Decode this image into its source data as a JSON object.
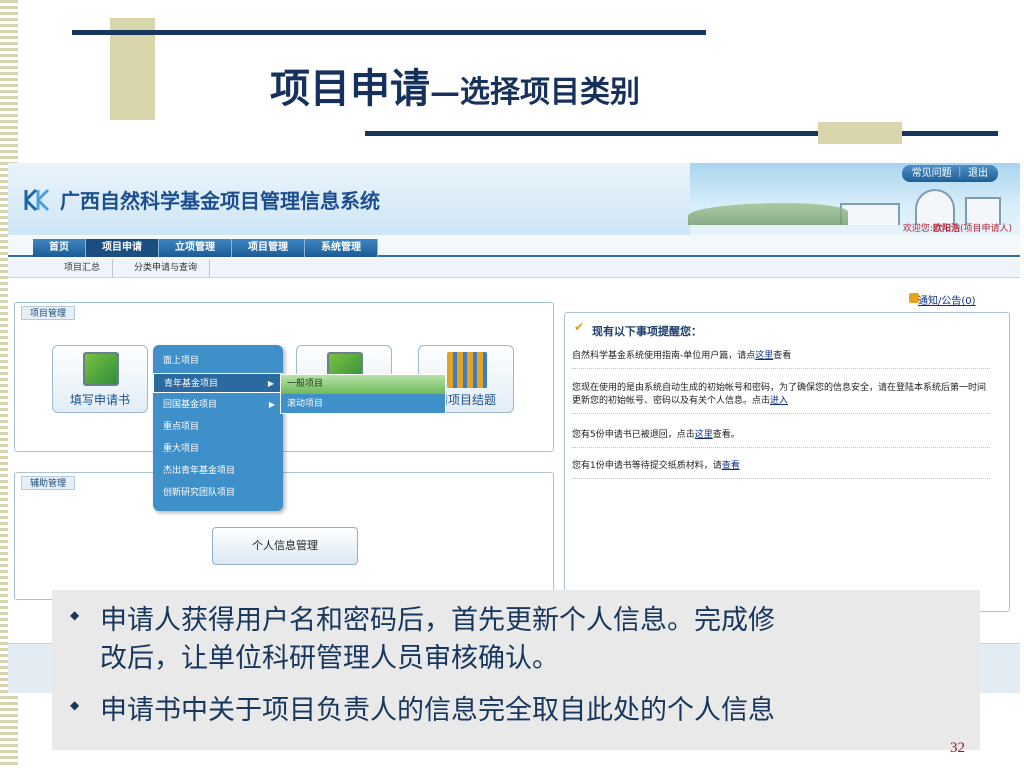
{
  "slide": {
    "title_main": "项目申请",
    "title_sub": "—选择项目类别",
    "page_number": "32"
  },
  "system": {
    "title": "广西自然科学基金项目管理信息系统",
    "top_links": "常见问题 ｜ 退出",
    "welcome_prefix": "欢迎您:",
    "welcome_user": "欧阳浩",
    "welcome_role": "(项目申请人)"
  },
  "main_nav": [
    "首页",
    "项目申请",
    "立项管理",
    "项目管理",
    "系统管理"
  ],
  "sub_nav": [
    "项目汇总",
    "分类申请与查询"
  ],
  "panels": {
    "project_mgmt_tab": "项目管理",
    "aux_mgmt_tab": "辅助管理"
  },
  "icon_buttons": {
    "fill_application": "填写申请书",
    "project_conclusion": "请项目结题"
  },
  "menu": {
    "items": [
      "面上项目",
      "青年基金项目",
      "回国基金项目",
      "重点项目",
      "重大项目",
      "杰出青年基金项目",
      "创新研究团队项目"
    ],
    "highlighted_index": 1,
    "arrow": "▶",
    "submenu": [
      "一般项目",
      "滚动项目"
    ]
  },
  "personal_info_button": "个人信息管理",
  "notices": {
    "link": "通知/公告(0)",
    "remind_title": "现有以下事项提醒您：",
    "rows": [
      {
        "pre": "自然科学基金系统使用指南-单位用户篇，请点",
        "link": "这里",
        "post": "查看"
      },
      {
        "pre": "您现在使用的是由系统自动生成的初始帐号和密码，为了确保您的信息安全，请在登陆本系统后第一时间更新您的初始帐号、密码以及有关个人信息。点击",
        "link": "进入",
        "post": ""
      },
      {
        "pre": "您有5份申请书已被退回，点击",
        "link": "这里",
        "post": "查看。"
      },
      {
        "pre": "您有1份申请书等待提交纸质材料，请",
        "link": "查看",
        "post": ""
      }
    ]
  },
  "notes": {
    "bullet_symbol": "◆",
    "line1": "申请人获得用户名和密码后，首先更新个人信息。完成修",
    "line2": "改后，让单位科研管理人员审核确认。",
    "line3": "申请书中关于项目负责人的信息完全取自此处的个人信息"
  },
  "colors": {
    "title": "#16325c",
    "decoration": "#d9d6ae",
    "nav": "#1a5b95",
    "menu": "#3f8fc8"
  }
}
